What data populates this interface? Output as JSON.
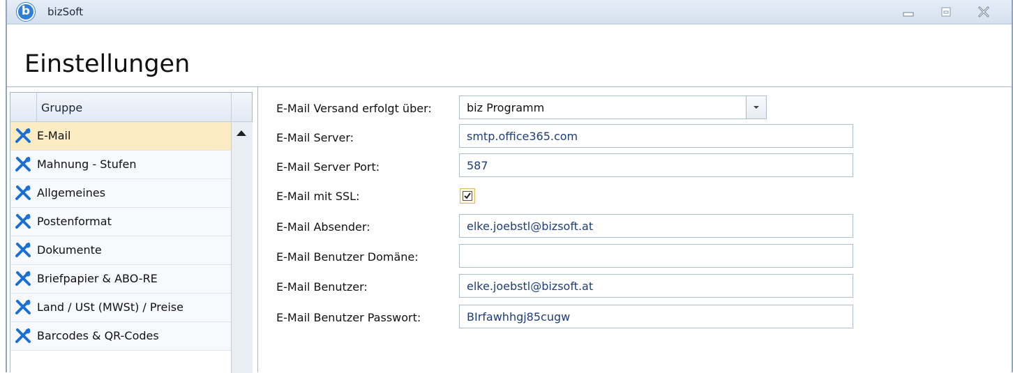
{
  "window": {
    "app_logo": "b",
    "title": "bizSoft",
    "controls": [
      "minimize-icon",
      "maximize-icon",
      "close-icon"
    ]
  },
  "page": {
    "title": "Einstellungen"
  },
  "grid": {
    "column_header": "Gruppe",
    "row_icon": "tools-icon",
    "items": [
      {
        "label": "E-Mail",
        "selected": true
      },
      {
        "label": "Mahnung - Stufen"
      },
      {
        "label": "Allgemeines"
      },
      {
        "label": "Postenformat"
      },
      {
        "label": "Dokumente"
      },
      {
        "label": "Briefpapier & ABO-RE"
      },
      {
        "label": "Land / USt (MWSt) / Preise"
      },
      {
        "label": "Barcodes & QR-Codes"
      }
    ]
  },
  "form": {
    "versand": {
      "label": "E-Mail Versand erfolgt über:",
      "value": "biz Programm"
    },
    "server": {
      "label": "E-Mail Server:",
      "value": "smtp.office365.com"
    },
    "port": {
      "label": "E-Mail Server Port:",
      "value": "587"
    },
    "ssl": {
      "label": "E-Mail mit SSL:",
      "checked": true
    },
    "absender": {
      "label": "E-Mail Absender:",
      "value": "elke.joebstl@bizsoft.at"
    },
    "domaene": {
      "label": "E-Mail Benutzer Domäne:",
      "value": ""
    },
    "benutzer": {
      "label": "E-Mail Benutzer:",
      "value": "elke.joebstl@bizsoft.at"
    },
    "passwort": {
      "label": "E-Mail Benutzer Passwort:",
      "value": "BIrfawhhgj85cugw"
    }
  },
  "colors": {
    "accent_blue": "#1a6fd4",
    "selection": "#fcecc4",
    "border": "#a8b6c8"
  }
}
